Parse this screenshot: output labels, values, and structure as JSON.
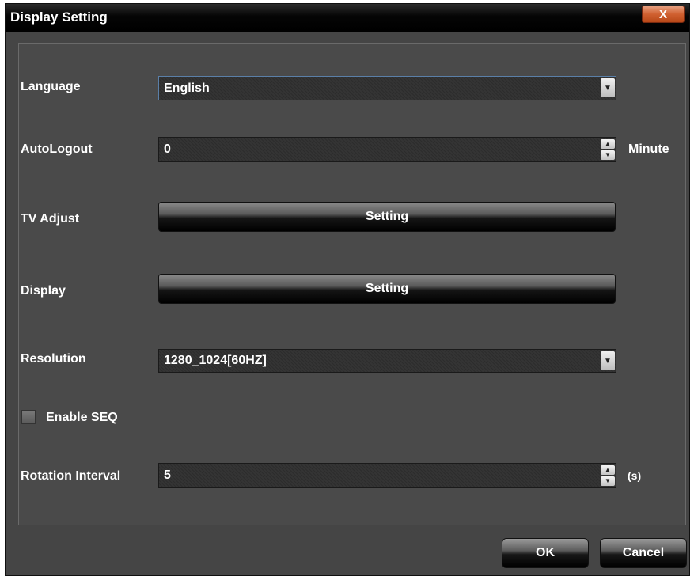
{
  "window": {
    "title": "Display Setting",
    "close_label": "X"
  },
  "form": {
    "language": {
      "label": "Language",
      "value": "English"
    },
    "auto_logout": {
      "label": "AutoLogout",
      "value": "0",
      "unit": "Minute"
    },
    "tv_adjust": {
      "label": "TV Adjust",
      "button_label": "Setting"
    },
    "display": {
      "label": "Display",
      "button_label": "Setting"
    },
    "resolution": {
      "label": "Resolution",
      "value": "1280_1024[60HZ]"
    },
    "enable_seq": {
      "label": "Enable SEQ",
      "checked": false
    },
    "rotation_interval": {
      "label": "Rotation Interval",
      "value": "5",
      "unit": "(s)"
    }
  },
  "footer": {
    "ok_label": "OK",
    "cancel_label": "Cancel"
  },
  "colors": {
    "window_bg": "#454545",
    "titlebar_bg": "#000000",
    "close_button": "#d06030",
    "focus_border": "#5a7fa8"
  },
  "icons": {
    "dropdown": "chevron-down-icon",
    "spinner": "spin-arrows-icon",
    "close": "close-icon"
  }
}
